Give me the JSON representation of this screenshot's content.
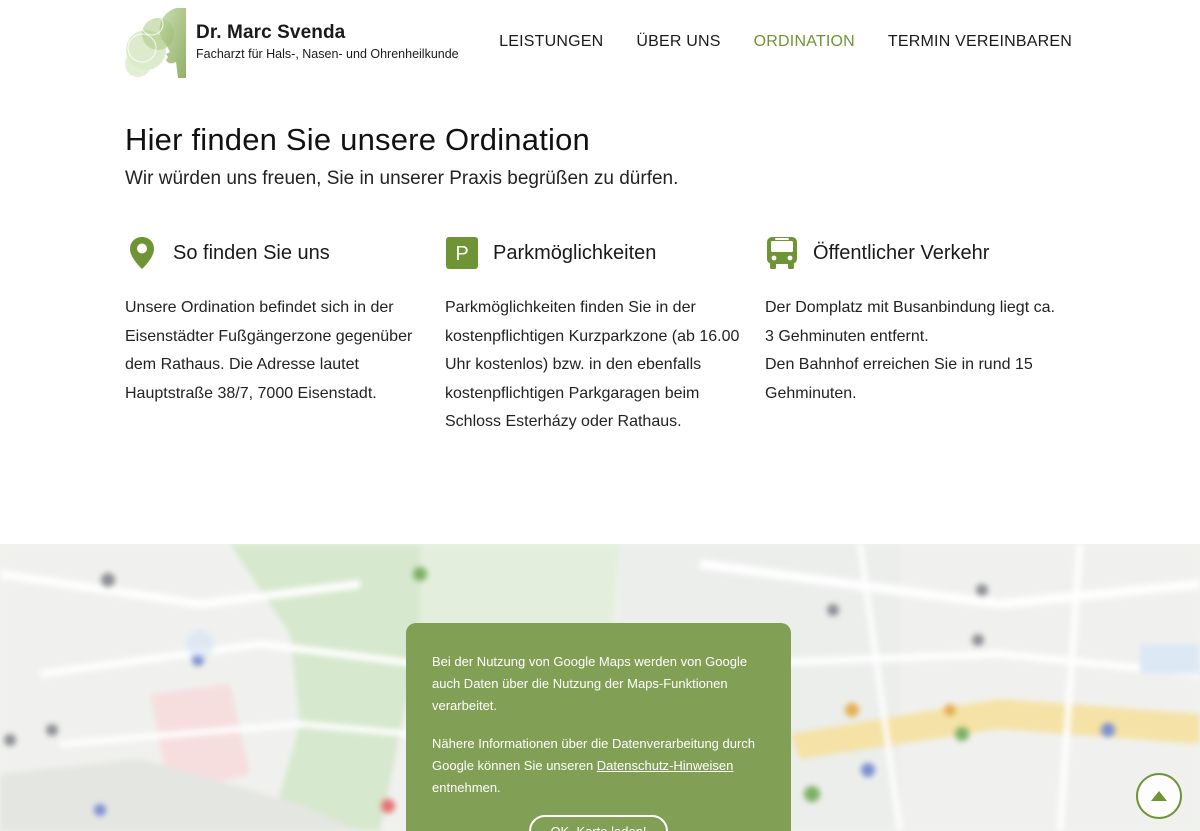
{
  "header": {
    "brand_name": "Dr. Marc Svenda",
    "brand_subtitle": "Facharzt für Hals-, Nasen- und Ohrenheilkunde",
    "nav": [
      {
        "label": "LEISTUNGEN",
        "active": false
      },
      {
        "label": "ÜBER UNS",
        "active": false
      },
      {
        "label": "ORDINATION",
        "active": true
      },
      {
        "label": "TERMIN VEREINBAREN",
        "active": false
      }
    ]
  },
  "intro": {
    "title": "Hier finden Sie unsere Ordination",
    "subtitle": "Wir würden uns freuen, Sie in unserer Praxis begrüßen zu dürfen."
  },
  "columns": [
    {
      "icon": "map-pin-icon",
      "title": "So finden Sie uns",
      "text": "Unsere Ordination befindet sich in der Eisenstädter Fußgängerzone gegenüber dem Rathaus. Die Adresse lautet Hauptstraße 38/7, 7000 Eisenstadt."
    },
    {
      "icon": "parking-icon",
      "icon_letter": "P",
      "title": "Parkmöglichkeiten",
      "text": "Parkmöglichkeiten finden Sie in der kostenpflichtigen Kurzparkzone (ab 16.00 Uhr kostenlos) bzw. in den ebenfalls kostenpflichtigen Parkgaragen beim Schloss Esterházy oder Rathaus."
    },
    {
      "icon": "bus-icon",
      "title": "Öffentlicher Verkehr",
      "text": "Der Domplatz mit Busanbindung liegt ca. 3 Gehminuten entfernt.\nDen Bahnhof erreichen Sie in rund 15 Gehminuten."
    }
  ],
  "consent": {
    "text1": "Bei der Nutzung von Google Maps werden von Google auch Daten über die Nutzung der Maps-Funktionen verarbeitet.",
    "text2_before": "Nähere Informationen über die Datenverarbeitung durch Google können Sie unseren ",
    "text2_link": "Datenschutz-Hinweisen ",
    "text2_after": "entnehmen.",
    "button_label": "OK, Karte laden!"
  },
  "colors": {
    "accent": "#6f9436",
    "consent_bg": "#82a055"
  },
  "scroll_top_icon": "arrow-up-icon"
}
